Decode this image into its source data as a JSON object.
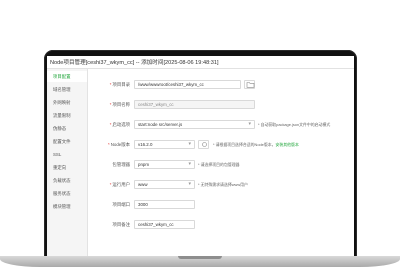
{
  "window": {
    "title": "Node项目管理[ceshi37_wkym_cc] -- 添加时间[2025-08-06 19:48:31]"
  },
  "sidebar": {
    "items": [
      {
        "label": "项目配置",
        "active": true
      },
      {
        "label": "域名管理",
        "active": false
      },
      {
        "label": "外网映射",
        "active": false
      },
      {
        "label": "流量限制",
        "active": false
      },
      {
        "label": "伪静态",
        "active": false
      },
      {
        "label": "配置文件",
        "active": false
      },
      {
        "label": "SSL",
        "active": false
      },
      {
        "label": "重定向",
        "active": false
      },
      {
        "label": "负载状态",
        "active": false
      },
      {
        "label": "服务状态",
        "active": false
      },
      {
        "label": "模块管理",
        "active": false
      }
    ]
  },
  "form": {
    "project_dir": {
      "label": "项目目录",
      "value": "/www/wwwroot/ceshi37_wkym_cc"
    },
    "project_name": {
      "label": "项目名称",
      "value": "ceshi37_wkym_cc"
    },
    "start_option": {
      "label": "启动选项",
      "value": "start:node src/server.js",
      "hint": "自动获取package.json文件中的启动模式"
    },
    "node_version": {
      "label": "Node版本",
      "value": "v16.2.0",
      "hint": "请根据项目选择合适的Node版本，",
      "hint_link": "安装其他版本"
    },
    "package_manager": {
      "label": "包管理器",
      "value": "pnpm",
      "hint": "请选择项目的包管理器"
    },
    "run_user": {
      "label": "运行用户",
      "value": "www",
      "hint": "无特殊需求请选择www用户"
    },
    "project_port": {
      "label": "项目端口",
      "value": "3000"
    },
    "project_note": {
      "label": "项目备注",
      "value": "ceshi37_wkym_cc"
    }
  },
  "colors": {
    "accent": "#20a53a",
    "required": "#e53935"
  },
  "icons": {
    "folder": "folder-icon",
    "refresh": "refresh-icon"
  }
}
